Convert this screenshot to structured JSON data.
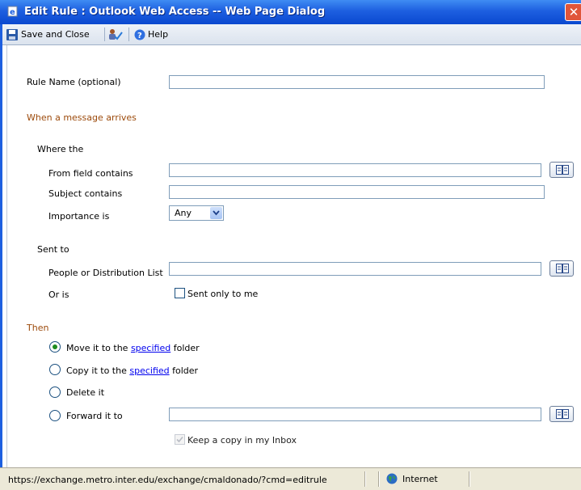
{
  "window": {
    "title": "Edit Rule : Outlook Web Access -- Web Page Dialog",
    "close_label": "✕"
  },
  "toolbar": {
    "save_close": "Save and Close",
    "help": "Help"
  },
  "form": {
    "rule_name_label": "Rule Name  (optional)",
    "rule_name_value": "",
    "when_section": "When a message arrives",
    "where_the": "Where the",
    "from_label": "From field contains",
    "from_value": "",
    "subject_label": "Subject contains",
    "subject_value": "",
    "importance_label": "Importance is",
    "importance_value": "Any",
    "sent_to": "Sent to",
    "people_label": "People or Distribution List",
    "people_value": "",
    "or_is_label": "Or is",
    "sent_only_label": "Sent only to me",
    "then_section": "Then",
    "move_prefix": "Move it to the",
    "move_link": "specified",
    "move_suffix": "folder",
    "copy_prefix": "Copy it to the",
    "copy_link": "specified",
    "copy_suffix": "folder",
    "delete_label": "Delete it",
    "forward_label": "Forward it to",
    "forward_value": "",
    "keep_copy_label": "Keep a copy in my Inbox"
  },
  "state": {
    "selected_action": "move",
    "sent_only_checked": false,
    "keep_copy_checked": true,
    "keep_copy_disabled": true
  },
  "status": {
    "url": "https://exchange.metro.inter.edu/exchange/cmaldonado/?cmd=editrule",
    "zone": "Internet"
  },
  "colors": {
    "section": "#9c4a0b",
    "titlebar": "#1d5fe0",
    "link": "#0000ee"
  }
}
